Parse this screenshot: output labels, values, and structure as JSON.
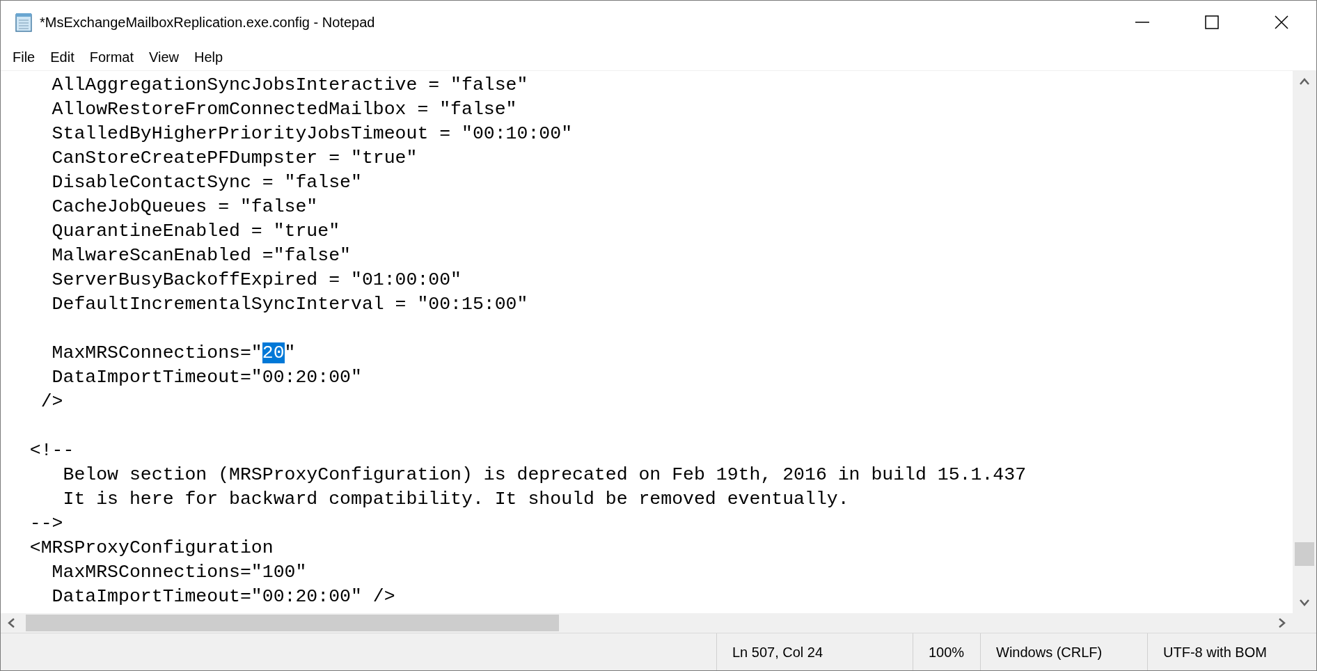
{
  "window": {
    "title": "*MsExchangeMailboxReplication.exe.config - Notepad"
  },
  "menu": [
    "File",
    "Edit",
    "Format",
    "View",
    "Help"
  ],
  "editor": {
    "lines": [
      {
        "kind": "text",
        "segments": [
          {
            "text": "    AllAggregationSyncJobsInteractive = \"false\"",
            "selected": false
          }
        ]
      },
      {
        "kind": "text",
        "segments": [
          {
            "text": "    AllowRestoreFromConnectedMailbox = \"false\"",
            "selected": false
          }
        ]
      },
      {
        "kind": "text",
        "segments": [
          {
            "text": "    StalledByHigherPriorityJobsTimeout = \"00:10:00\"",
            "selected": false
          }
        ]
      },
      {
        "kind": "text",
        "segments": [
          {
            "text": "    CanStoreCreatePFDumpster = \"true\"",
            "selected": false
          }
        ]
      },
      {
        "kind": "text",
        "segments": [
          {
            "text": "    DisableContactSync = \"false\"",
            "selected": false
          }
        ]
      },
      {
        "kind": "text",
        "segments": [
          {
            "text": "    CacheJobQueues = \"false\"",
            "selected": false
          }
        ]
      },
      {
        "kind": "text",
        "segments": [
          {
            "text": "    QuarantineEnabled = \"true\"",
            "selected": false
          }
        ]
      },
      {
        "kind": "text",
        "segments": [
          {
            "text": "    MalwareScanEnabled =\"false\"",
            "selected": false
          }
        ]
      },
      {
        "kind": "text",
        "segments": [
          {
            "text": "    ServerBusyBackoffExpired = \"01:00:00\"",
            "selected": false
          }
        ]
      },
      {
        "kind": "text",
        "segments": [
          {
            "text": "    DefaultIncrementalSyncInterval = \"00:15:00\"",
            "selected": false
          }
        ]
      },
      {
        "kind": "blank"
      },
      {
        "kind": "text",
        "segments": [
          {
            "text": "    MaxMRSConnections=\"",
            "selected": false
          },
          {
            "text": "20",
            "selected": true
          },
          {
            "text": "\"",
            "selected": false
          }
        ]
      },
      {
        "kind": "text",
        "segments": [
          {
            "text": "    DataImportTimeout=\"00:20:00\"",
            "selected": false
          }
        ]
      },
      {
        "kind": "text",
        "segments": [
          {
            "text": "   />",
            "selected": false
          }
        ]
      },
      {
        "kind": "blank"
      },
      {
        "kind": "text",
        "segments": [
          {
            "text": "  <!--",
            "selected": false
          }
        ]
      },
      {
        "kind": "text",
        "segments": [
          {
            "text": "     Below section (MRSProxyConfiguration) is deprecated on Feb 19th, 2016 in build 15.1.437",
            "selected": false
          }
        ]
      },
      {
        "kind": "text",
        "segments": [
          {
            "text": "     It is here for backward compatibility. It should be removed eventually.",
            "selected": false
          }
        ]
      },
      {
        "kind": "text",
        "segments": [
          {
            "text": "  -->",
            "selected": false
          }
        ]
      },
      {
        "kind": "text",
        "segments": [
          {
            "text": "  <MRSProxyConfiguration",
            "selected": false
          }
        ]
      },
      {
        "kind": "text",
        "segments": [
          {
            "text": "    MaxMRSConnections=\"100\"",
            "selected": false
          }
        ]
      },
      {
        "kind": "text",
        "segments": [
          {
            "text": "    DataImportTimeout=\"00:20:00\" />",
            "selected": false
          }
        ]
      }
    ]
  },
  "status_bar": [
    "Ln 507, Col 24",
    "100%",
    "Windows (CRLF)",
    "UTF-8 with BOM"
  ]
}
